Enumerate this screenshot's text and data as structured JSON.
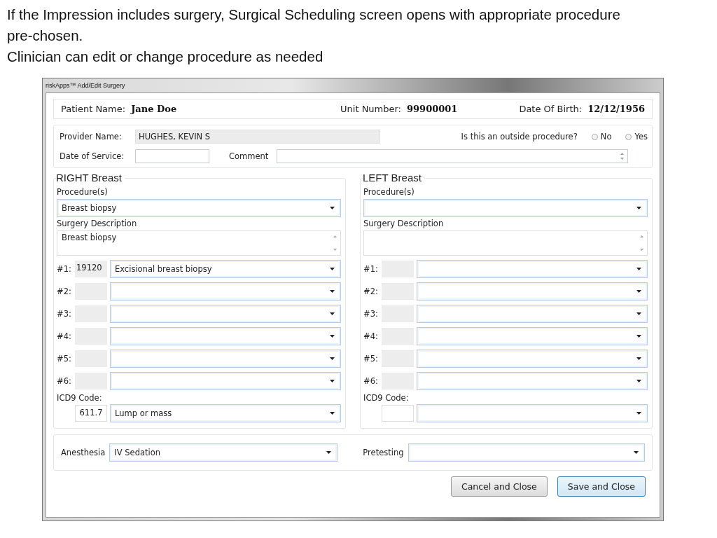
{
  "caption": {
    "lines": [
      "If the Impression includes surgery, Surgical Scheduling screen opens with appropriate procedure pre-chosen.",
      "Clinician can edit or change procedure as needed"
    ]
  },
  "window": {
    "title": "riskApps™ Add/Edit Surgery"
  },
  "header": {
    "patient_label": "Patient Name:",
    "patient": "Jane Doe",
    "unit_label": "Unit Number:",
    "unit": "99900001",
    "dob_label": "Date Of Birth:",
    "dob": "12/12/1956"
  },
  "provider": {
    "label": "Provider Name:",
    "value": "HUGHES, KEVIN S",
    "outside_question": "Is this an outside procedure?",
    "outside_options": [
      {
        "label": "No",
        "selected": false
      },
      {
        "label": "Yes",
        "selected": false
      }
    ],
    "date_label": "Date of Service:",
    "comment_label": "Comment"
  },
  "sides": [
    {
      "title": "RIGHT Breast",
      "procedure_label": "Procedure(s)",
      "procedure": "Breast biopsy",
      "description_label": "Surgery Description",
      "description": "Breast biopsy",
      "codes": [
        {
          "label": "#1:",
          "code": "19120",
          "procedure": "Excisional breast biopsy"
        },
        {
          "label": "#2:"
        },
        {
          "label": "#3:"
        },
        {
          "label": "#4:"
        },
        {
          "label": "#5:"
        },
        {
          "label": "#6:"
        }
      ],
      "icd9_label": "ICD9 Code:",
      "icd9_code": "611.7",
      "icd9_desc": "Lump or mass"
    },
    {
      "title": "LEFT Breast",
      "procedure_label": "Procedure(s)",
      "description_label": "Surgery Description",
      "codes": [
        {
          "label": "#1:"
        },
        {
          "label": "#2:"
        },
        {
          "label": "#3:"
        },
        {
          "label": "#4:"
        },
        {
          "label": "#5:"
        },
        {
          "label": "#6:"
        }
      ],
      "icd9_label": "ICD9 Code:"
    }
  ],
  "bottom": {
    "anesthesia_label": "Anesthesia",
    "anesthesia": "IV Sedation",
    "pretesting_label": "Pretesting"
  },
  "buttons": [
    {
      "label": "Cancel and Close",
      "kind": "normal"
    },
    {
      "label": "Save and Close",
      "kind": "default"
    }
  ]
}
